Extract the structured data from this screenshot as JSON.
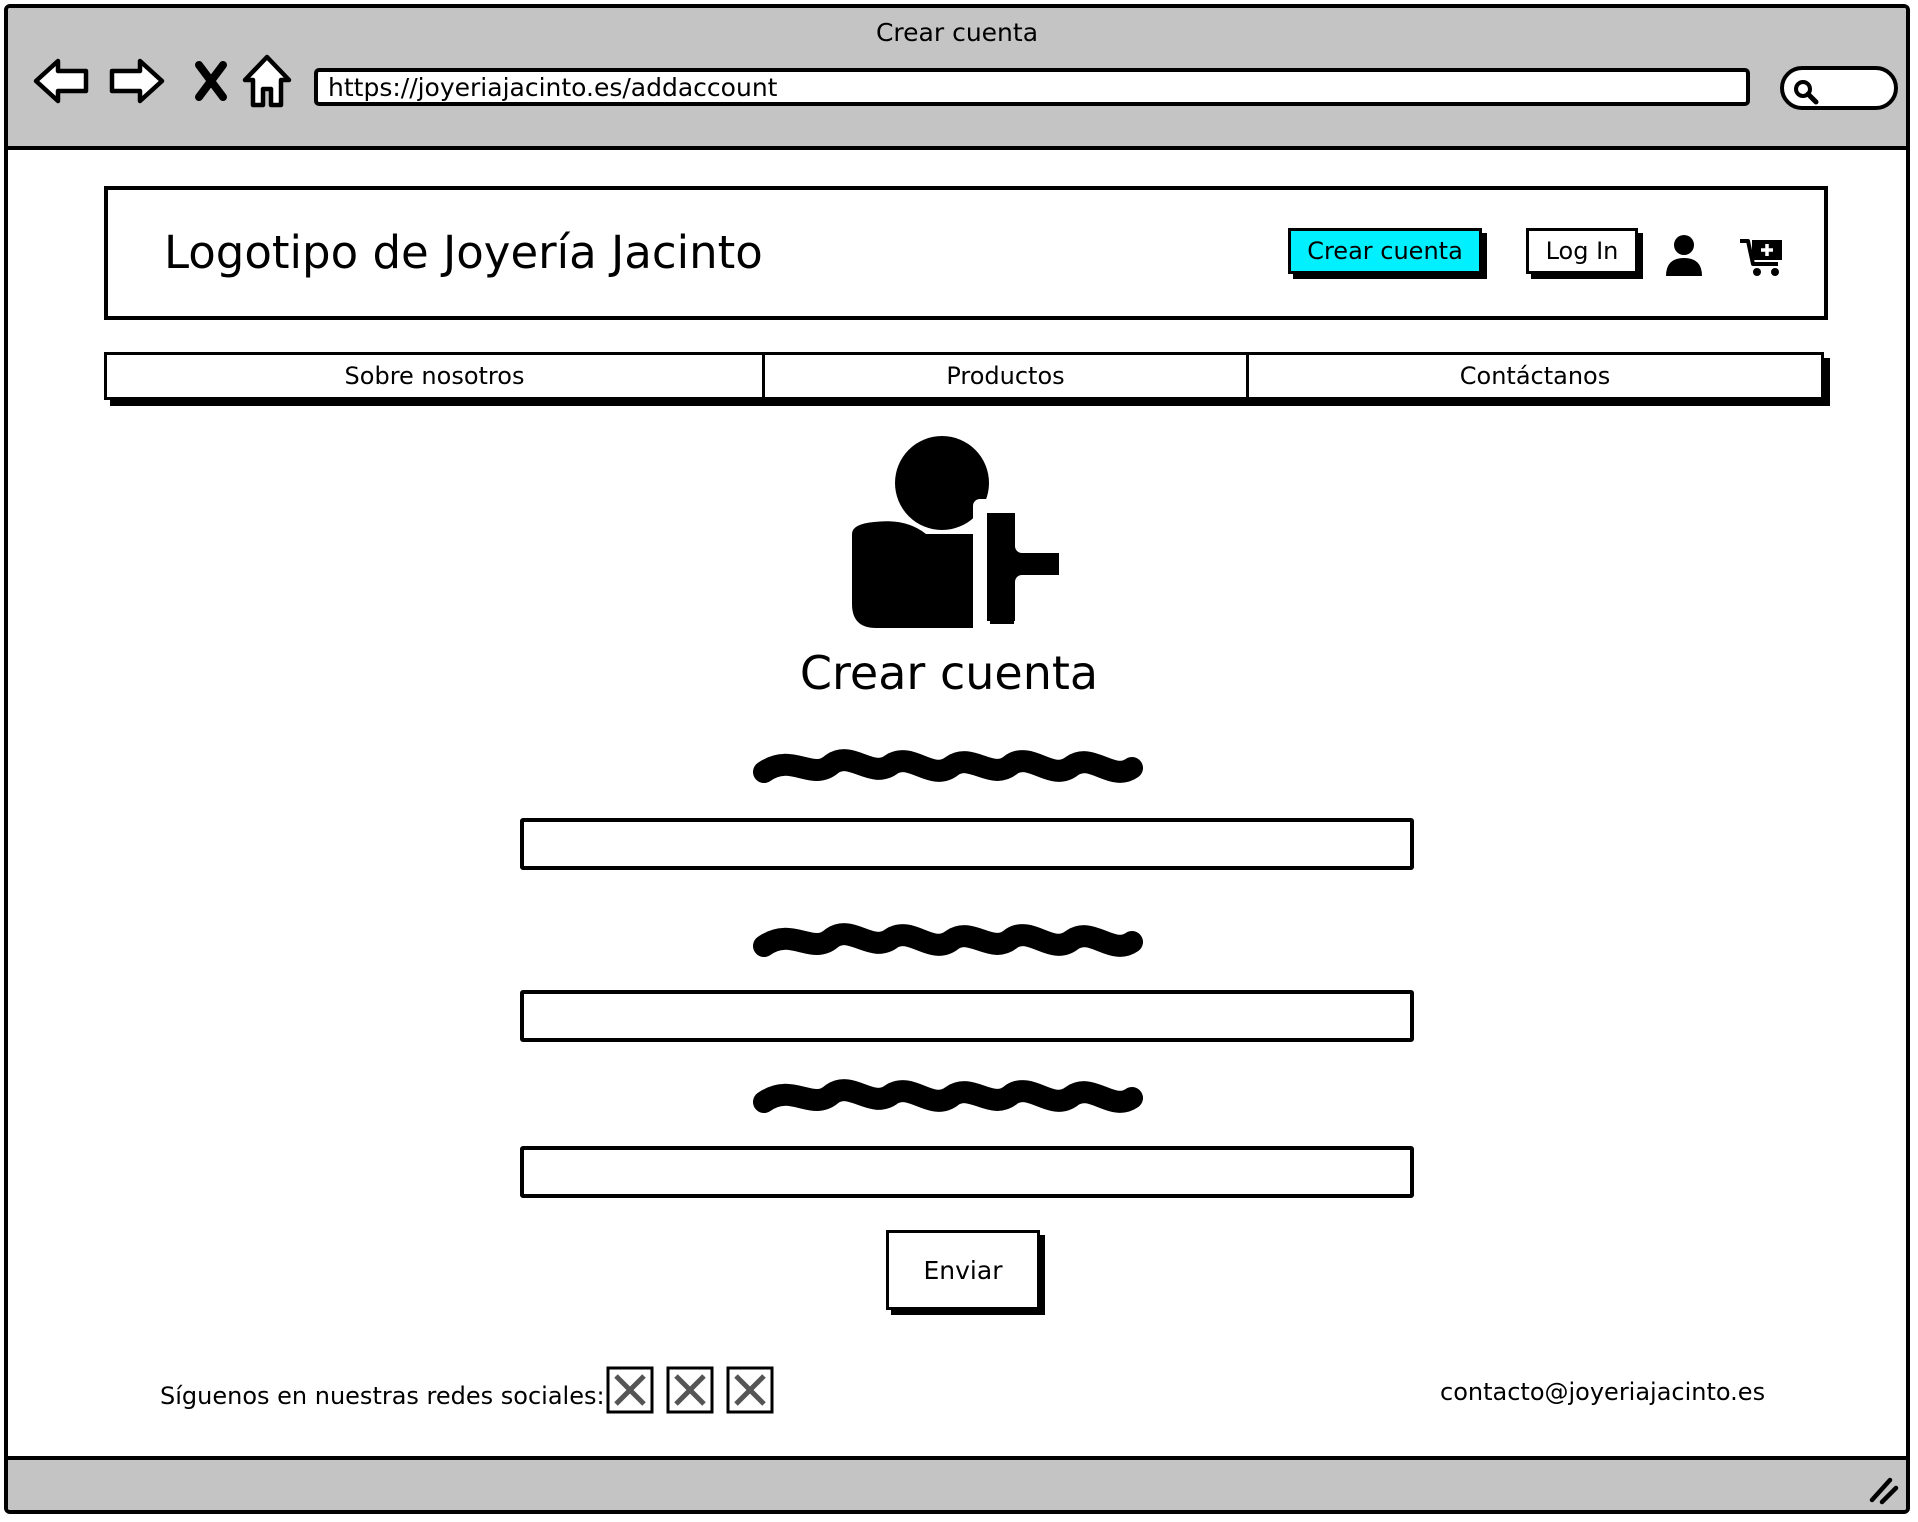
{
  "browser": {
    "title": "Crear cuenta",
    "url": "https://joyeriajacinto.es/addaccount"
  },
  "header": {
    "logo": "Logotipo de Joyería Jacinto",
    "create_account_label": "Crear cuenta",
    "login_label": "Log In",
    "accent_color": "#00f0ff"
  },
  "nav": {
    "items": [
      {
        "label": "Sobre nosotros"
      },
      {
        "label": "Productos"
      },
      {
        "label": "Contáctanos"
      }
    ]
  },
  "form": {
    "icon": "user-add-icon",
    "title": "Crear cuenta",
    "fields": [
      {
        "value": ""
      },
      {
        "value": ""
      },
      {
        "value": ""
      }
    ],
    "submit_label": "Enviar"
  },
  "footer": {
    "social_label": "Síguenos en nuestras redes sociales:",
    "email": "contacto@joyeriajacinto.es"
  }
}
